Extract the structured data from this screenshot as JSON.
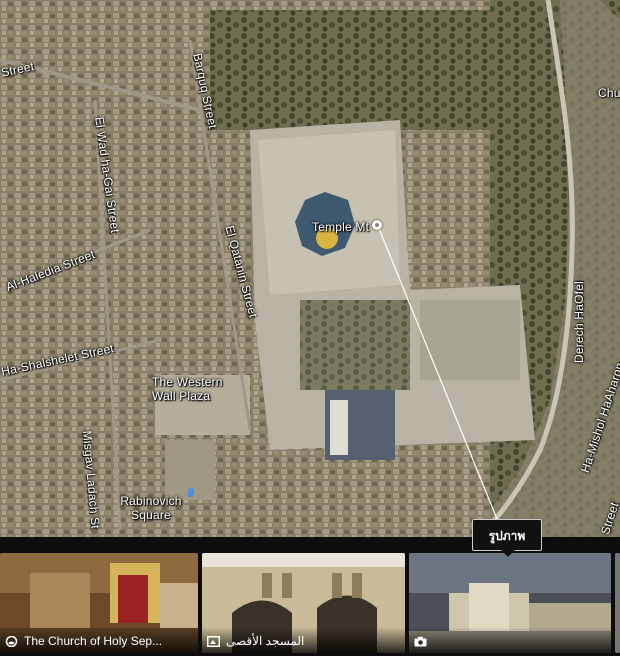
{
  "map": {
    "labels": {
      "street_nw": "Street",
      "bab_el_silsila_west": "Chu",
      "barquq": "Barquq Street",
      "el_wad": "El Wad ha-Gai Street",
      "al_haledia": "Al-Haledia Street",
      "el_qatanin": "El Qatanin Street",
      "shalshelet": "Ha-Shalshelet Street",
      "western_wall_plaza": "The Western Wall Plaza",
      "misgav_ladach": "Misgav Ladach St",
      "rabinovich": "Rabinovich Square",
      "derech_haofel": "Derech HaOfel",
      "mishol_haaharon": "Ha-Mishol HaAharon",
      "street_se": "Street"
    },
    "pin": {
      "label": "Temple Mt",
      "icon": "place-dot-icon"
    }
  },
  "photos": {
    "tooltip": "รูปภาพ",
    "items": [
      {
        "caption": "The Church of Holy Sep...",
        "icon": "panorama-icon"
      },
      {
        "caption": "المسجد الأقصى",
        "icon": "photo-sphere-icon"
      },
      {
        "caption": "",
        "icon": "camera-icon"
      }
    ]
  }
}
